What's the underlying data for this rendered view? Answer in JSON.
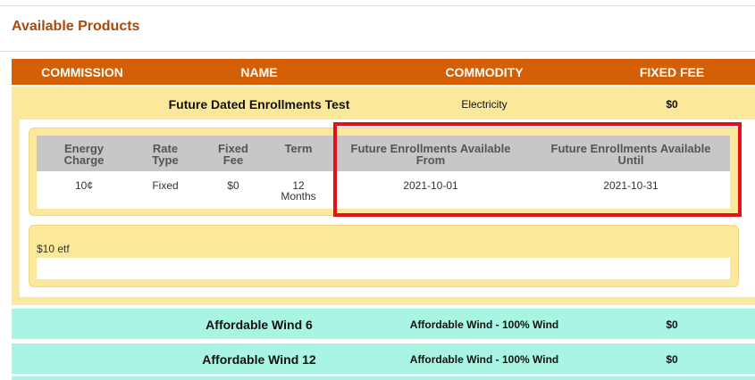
{
  "page": {
    "title": "Available Products"
  },
  "table": {
    "headers": {
      "commission": "COMMISSION",
      "name": "NAME",
      "commodity": "COMMODITY",
      "fixed_fee": "FIXED FEE"
    }
  },
  "products": [
    {
      "name": "Future Dated Enrollments Test",
      "commodity": "Electricity",
      "fixed_fee": "$0",
      "rate_headers": {
        "energy_charge_1": "Energy",
        "energy_charge_2": "Charge",
        "rate_type_1": "Rate",
        "rate_type_2": "Type",
        "fixed_fee_1": "Fixed",
        "fixed_fee_2": "Fee",
        "term": "Term",
        "avail_from_1": "Future Enrollments Available",
        "avail_from_2": "From",
        "avail_until_1": "Future Enrollments Available",
        "avail_until_2": "Until"
      },
      "rate": {
        "energy_charge": "10¢",
        "rate_type": "Fixed",
        "fixed_fee": "$0",
        "term_1": "12",
        "term_2": "Months",
        "available_from": "2021-10-01",
        "available_until": "2021-10-31"
      },
      "note": "$10 etf"
    },
    {
      "name": "Affordable Wind 6",
      "commodity": "Affordable Wind - 100% Wind",
      "fixed_fee": "$0"
    },
    {
      "name": "Affordable Wind 12",
      "commodity": "Affordable Wind - 100% Wind",
      "fixed_fee": "$0"
    }
  ],
  "colors": {
    "title": "#a84a0d",
    "header_bg": "#d45f05",
    "expanded_bg": "#fce89a",
    "wind_bg": "#a8f5e3",
    "highlight": "#e3121a"
  }
}
